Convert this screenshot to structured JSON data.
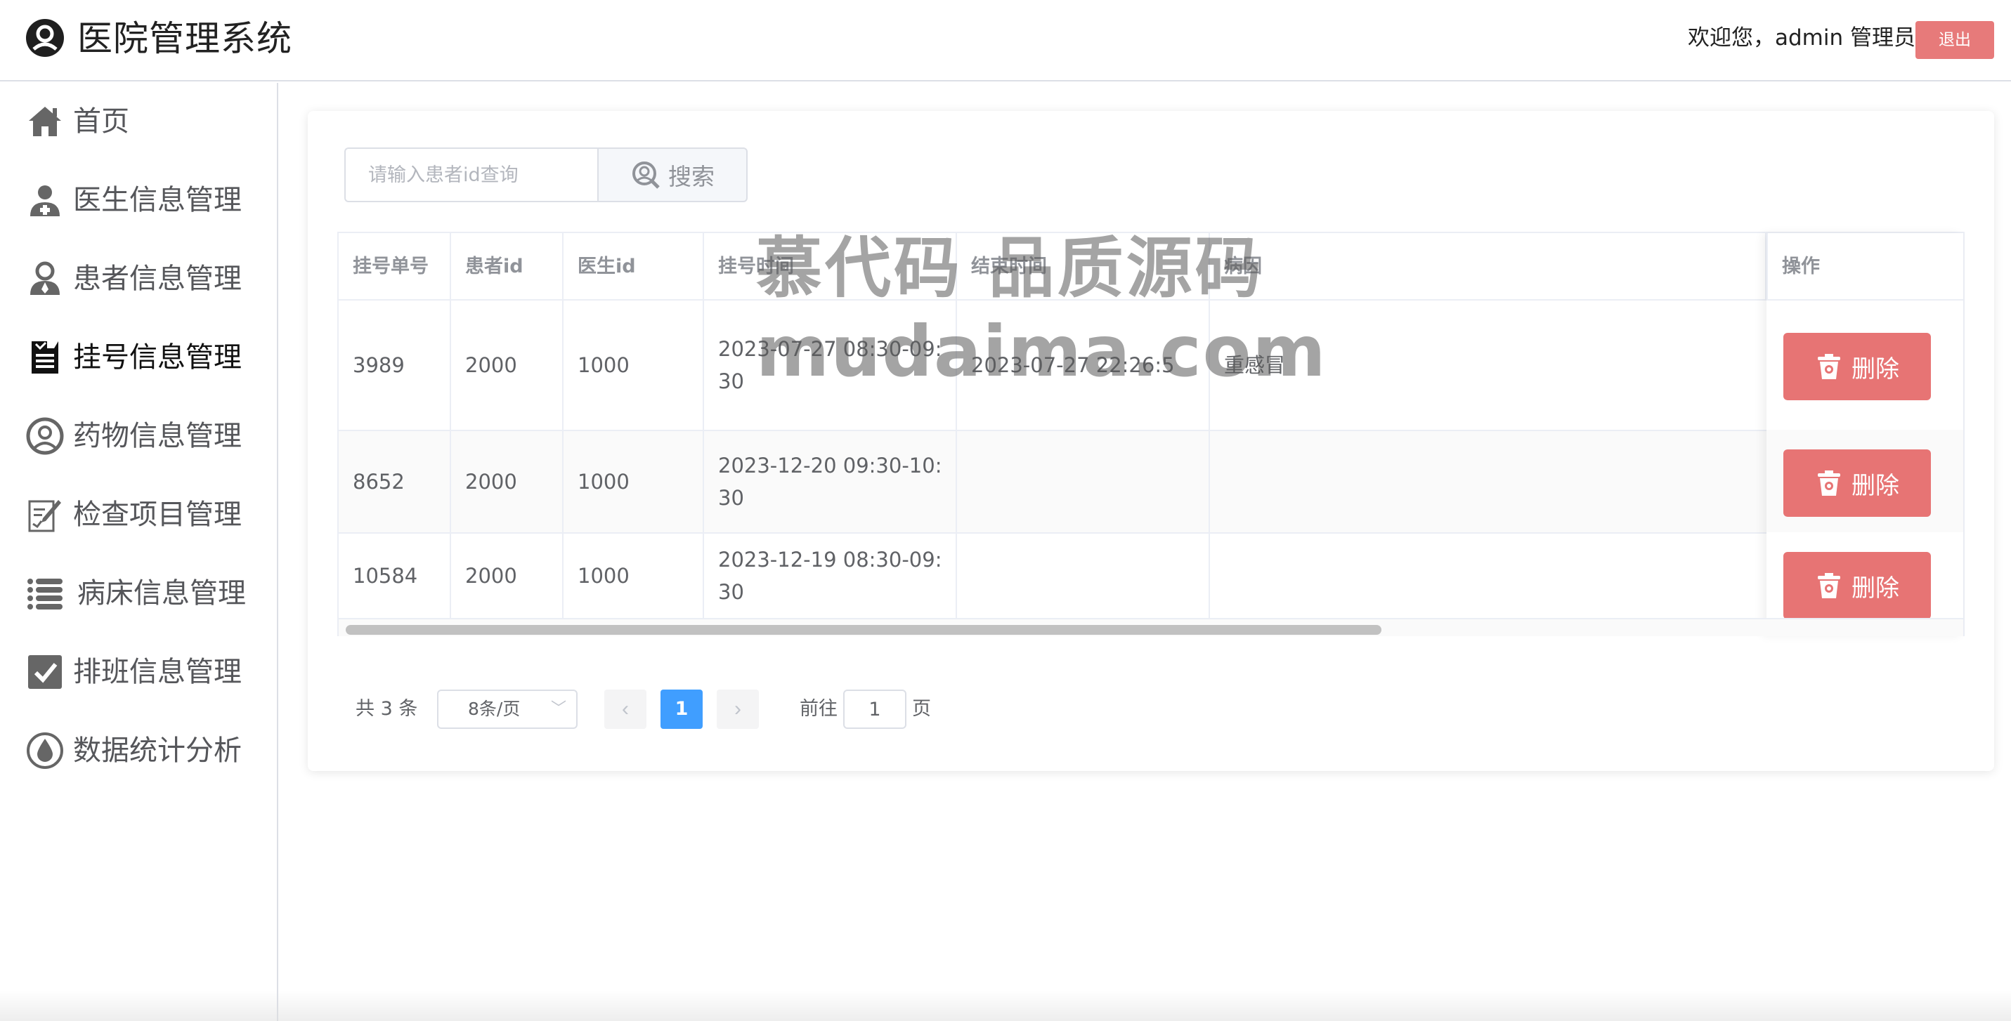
{
  "header": {
    "title": "医院管理系统",
    "welcome": "欢迎您，admin 管理员",
    "logout_label": "退出"
  },
  "sidebar": {
    "items": [
      {
        "label": "首页",
        "icon": "home-icon"
      },
      {
        "label": "医生信息管理",
        "icon": "doctor-icon"
      },
      {
        "label": "患者信息管理",
        "icon": "patient-icon"
      },
      {
        "label": "挂号信息管理",
        "icon": "clipboard-icon"
      },
      {
        "label": "药物信息管理",
        "icon": "medicine-icon"
      },
      {
        "label": "检查项目管理",
        "icon": "edit-checklist-icon"
      },
      {
        "label": "病床信息管理",
        "icon": "list-icon"
      },
      {
        "label": "排班信息管理",
        "icon": "checkbox-icon"
      },
      {
        "label": "数据统计分析",
        "icon": "drop-icon"
      }
    ],
    "active_index": 3
  },
  "search": {
    "placeholder": "请输入患者id查询",
    "value": "",
    "button_label": "搜索"
  },
  "table": {
    "columns": [
      "挂号单号",
      "患者id",
      "医生id",
      "挂号时间",
      "结束时间",
      "病因",
      "操作"
    ],
    "rows": [
      {
        "id": "3989",
        "patient_id": "2000",
        "doctor_id": "1000",
        "reg_time": "2023-07-27 08:30-09:30",
        "end_time": "2023-07-27 22:26:5",
        "cause": "重感冒",
        "action": "删除"
      },
      {
        "id": "8652",
        "patient_id": "2000",
        "doctor_id": "1000",
        "reg_time": "2023-12-20 09:30-10:30",
        "end_time": "",
        "cause": "",
        "action": "删除"
      },
      {
        "id": "10584",
        "patient_id": "2000",
        "doctor_id": "1000",
        "reg_time": "2023-12-19 08:30-09:30",
        "end_time": "",
        "cause": "",
        "action": "删除"
      }
    ]
  },
  "pagination": {
    "total_text": "共 3 条",
    "page_size": "8条/页",
    "current_page": "1",
    "goto_label": "前往",
    "goto_value": "1",
    "page_suffix": "页"
  },
  "watermark": {
    "line1": "慕代码 品质源码",
    "line2": "mudaima.com"
  },
  "colors": {
    "accent": "#409eff",
    "danger": "#e77474",
    "logout": "#e77a7a"
  }
}
